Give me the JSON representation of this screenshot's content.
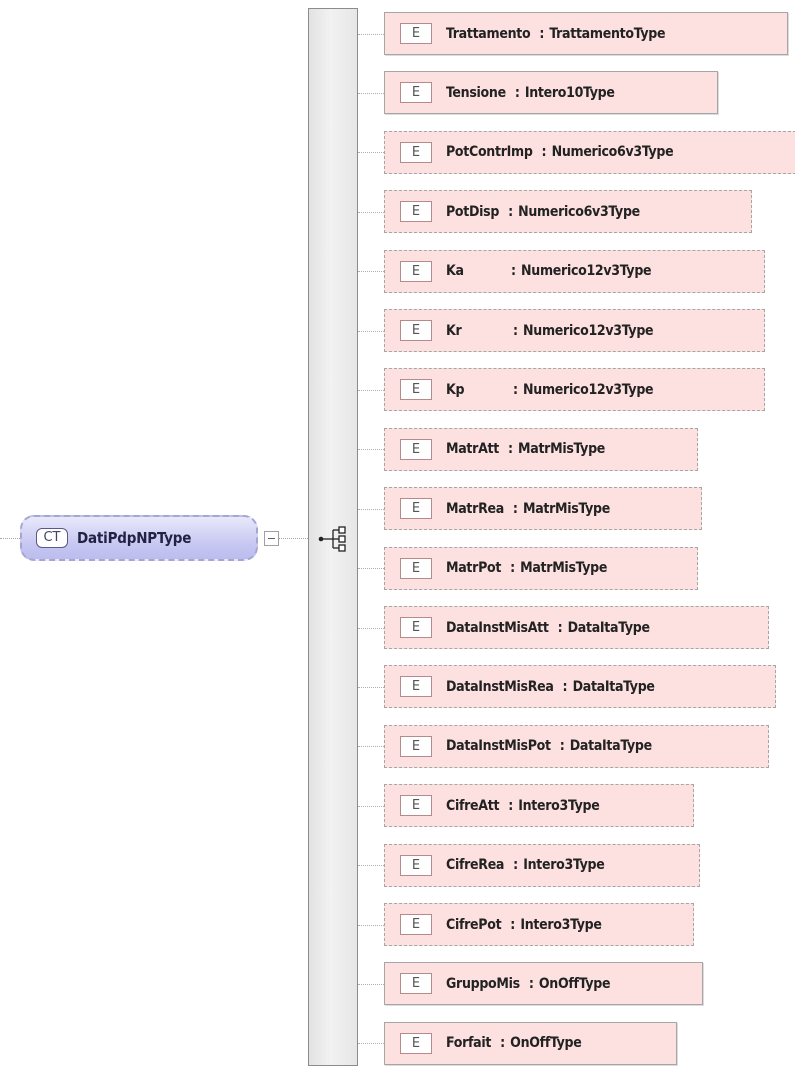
{
  "complex_type": {
    "tag": "CT",
    "name": "DatiPdpNPType"
  },
  "element_tag": "E",
  "colors": {
    "element_fill": "#fde0e0",
    "complex_type_fill": "#c9c9f3",
    "sequence_fill": "#e8e8e8"
  },
  "icons": {
    "collapse": "minus-box-icon",
    "sequence": "sequence-compositor-icon"
  },
  "elements": [
    {
      "name": "Trattamento",
      "type": "TrattamentoType",
      "optional": false
    },
    {
      "name": "Tensione",
      "type": "Intero10Type",
      "optional": false
    },
    {
      "name": "PotContrImp",
      "type": "Numerico6v3Type",
      "optional": true
    },
    {
      "name": "PotDisp",
      "type": "Numerico6v3Type",
      "optional": true
    },
    {
      "name": "Ka",
      "type": "Numerico12v3Type",
      "optional": true
    },
    {
      "name": "Kr",
      "type": "Numerico12v3Type",
      "optional": true
    },
    {
      "name": "Kp",
      "type": "Numerico12v3Type",
      "optional": true
    },
    {
      "name": "MatrAtt",
      "type": "MatrMisType",
      "optional": true
    },
    {
      "name": "MatrRea",
      "type": "MatrMisType",
      "optional": true
    },
    {
      "name": "MatrPot",
      "type": "MatrMisType",
      "optional": true
    },
    {
      "name": "DataInstMisAtt",
      "type": "DataItaType",
      "optional": true
    },
    {
      "name": "DataInstMisRea",
      "type": "DataItaType",
      "optional": true
    },
    {
      "name": "DataInstMisPot",
      "type": "DataItaType",
      "optional": true
    },
    {
      "name": "CifreAtt",
      "type": "Intero3Type",
      "optional": true
    },
    {
      "name": "CifreRea",
      "type": "Intero3Type",
      "optional": true
    },
    {
      "name": "CifrePot",
      "type": "Intero3Type",
      "optional": true
    },
    {
      "name": "GruppoMis",
      "type": "OnOffType",
      "optional": false
    },
    {
      "name": "Forfait",
      "type": "OnOffType",
      "optional": false
    }
  ]
}
